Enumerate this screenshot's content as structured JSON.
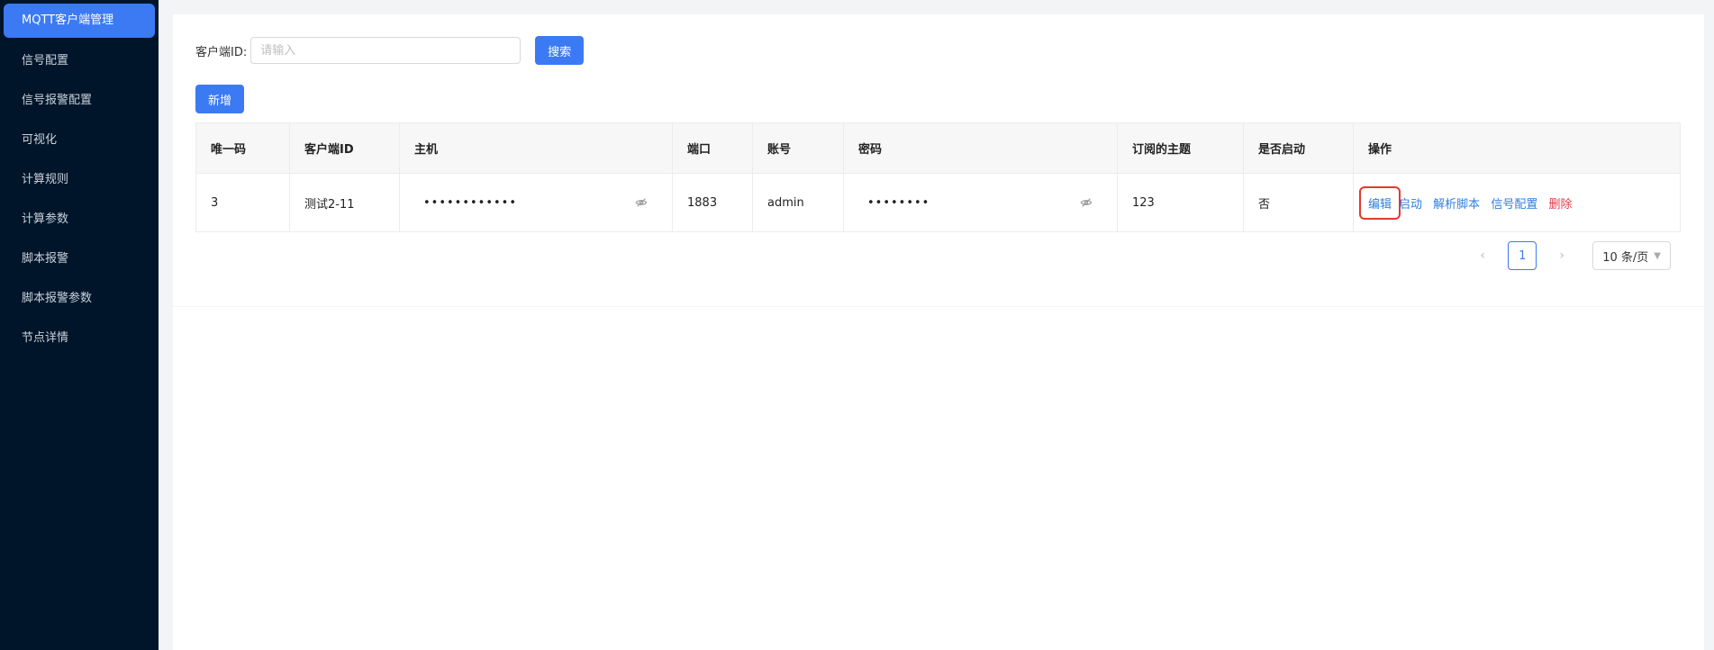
{
  "sidebar": {
    "items": [
      {
        "label": "MQTT客户端管理",
        "active": true
      },
      {
        "label": "信号配置"
      },
      {
        "label": "信号报警配置"
      },
      {
        "label": "可视化"
      },
      {
        "label": "计算规则"
      },
      {
        "label": "计算参数"
      },
      {
        "label": "脚本报警"
      },
      {
        "label": "脚本报警参数"
      },
      {
        "label": "节点详情"
      }
    ]
  },
  "search": {
    "label": "客户端ID:",
    "placeholder": "请输入",
    "value": "",
    "button": "搜索"
  },
  "toolbar": {
    "add_label": "新增"
  },
  "table": {
    "columns": [
      "唯一码",
      "客户端ID",
      "主机",
      "端口",
      "账号",
      "密码",
      "订阅的主题",
      "是否启动",
      "操作"
    ],
    "rows": [
      {
        "id": "3",
        "client_id": "测试2-11",
        "host_masked": "••••••••••••",
        "port": "1883",
        "account": "admin",
        "password_masked": "••••••••",
        "topic": "123",
        "enabled": "否",
        "actions": {
          "edit": "编辑",
          "start": "启动",
          "parse_script": "解析脚本",
          "signal_config": "信号配置",
          "delete": "删除"
        }
      }
    ]
  },
  "pagination": {
    "current": "1",
    "page_size": "10 条/页"
  },
  "colors": {
    "primary": "#3b7af3",
    "sidebar_bg": "#001529",
    "danger": "#e5384a",
    "highlight_box": "#e43a2d"
  }
}
